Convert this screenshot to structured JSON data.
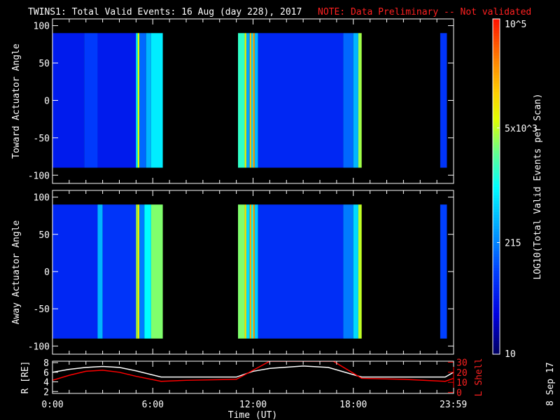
{
  "chart_data": {
    "type": "heatmap",
    "title": "TWINS1: Total Valid Events: 16 Aug (day 228), 2017",
    "note": "NOTE: Data Preliminary -- Not validated",
    "date_stamp": "8 Sep 17",
    "xlabel": "Time (UT)",
    "xlim": [
      0,
      24
    ],
    "xticks": [
      {
        "v": 0,
        "label": "0:00"
      },
      {
        "v": 6,
        "label": "6:00"
      },
      {
        "v": 12,
        "label": "12:00"
      },
      {
        "v": 18,
        "label": "18:00"
      },
      {
        "v": 23.983,
        "label": "23:59"
      }
    ],
    "colorbar": {
      "label": "LOG10(Total Valid Events per Scan)",
      "scale": "log10",
      "range": [
        1,
        5
      ],
      "ticks": [
        {
          "v": 5,
          "label": "10^5"
        },
        {
          "v": 3.699,
          "label": "5x10^3"
        },
        {
          "v": 2.332,
          "label": "215"
        },
        {
          "v": 1,
          "label": "10"
        }
      ]
    },
    "panels": [
      {
        "ylabel": "Toward Actuator Angle",
        "ylim": [
          -111,
          109
        ],
        "yticks": [
          100,
          50,
          0,
          -50,
          -100
        ],
        "angle_range": [
          -90,
          90
        ],
        "bands_hours_log10": [
          [
            0,
            1.9,
            1.7
          ],
          [
            1.9,
            2.7,
            1.95
          ],
          [
            2.7,
            5.0,
            1.7
          ],
          [
            5.0,
            5.1,
            3.0
          ],
          [
            5.1,
            5.2,
            3.8
          ],
          [
            5.2,
            5.6,
            2.2
          ],
          [
            5.6,
            5.9,
            2.6
          ],
          [
            5.9,
            6.6,
            2.9
          ],
          [
            11.1,
            11.5,
            3.2
          ],
          [
            11.5,
            11.6,
            3.9
          ],
          [
            11.6,
            11.8,
            2.5
          ],
          [
            11.8,
            11.9,
            4.2
          ],
          [
            11.9,
            12.0,
            2.8
          ],
          [
            12.0,
            12.1,
            4.4
          ],
          [
            12.1,
            12.3,
            2.6
          ],
          [
            12.3,
            17.4,
            1.8
          ],
          [
            17.4,
            18.0,
            2.2
          ],
          [
            18.0,
            18.3,
            2.6
          ],
          [
            18.3,
            18.5,
            3.6
          ],
          [
            23.2,
            23.6,
            1.9
          ]
        ]
      },
      {
        "ylabel": "Away Actuator Angle",
        "ylim": [
          -111,
          109
        ],
        "yticks": [
          100,
          50,
          0,
          -50,
          -100
        ],
        "angle_range": [
          -90,
          90
        ],
        "bands_hours_log10": [
          [
            0,
            2.7,
            1.8
          ],
          [
            2.7,
            3.0,
            2.6
          ],
          [
            3.0,
            5.0,
            1.9
          ],
          [
            5.0,
            5.1,
            3.6
          ],
          [
            5.1,
            5.2,
            3.9
          ],
          [
            5.2,
            5.5,
            2.3
          ],
          [
            5.5,
            5.9,
            3.0
          ],
          [
            5.9,
            6.6,
            3.5
          ],
          [
            11.1,
            11.5,
            3.5
          ],
          [
            11.5,
            11.6,
            4.0
          ],
          [
            11.6,
            11.8,
            2.8
          ],
          [
            11.8,
            11.9,
            4.3
          ],
          [
            11.9,
            12.0,
            3.0
          ],
          [
            12.0,
            12.1,
            4.4
          ],
          [
            12.1,
            12.3,
            2.7
          ],
          [
            12.3,
            17.4,
            1.85
          ],
          [
            17.4,
            18.0,
            2.3
          ],
          [
            18.0,
            18.3,
            2.8
          ],
          [
            18.3,
            18.5,
            3.7
          ],
          [
            23.2,
            23.6,
            2.0
          ]
        ]
      }
    ],
    "orbit": {
      "ylabel_left": "R [RE]",
      "ylabel_right": "L Shell",
      "ylim_left": [
        1.6,
        8.3
      ],
      "ylim_right": [
        -1,
        31
      ],
      "yticks_left": [
        2,
        4,
        6,
        8
      ],
      "yticks_right": [
        0,
        10,
        20,
        30
      ],
      "series": [
        {
          "name": "R",
          "color": "#ffffff",
          "x": [
            0,
            1,
            2,
            3,
            4,
            5,
            6.5,
            11,
            12,
            13,
            15,
            16.5,
            18.5,
            23.5,
            24
          ],
          "y": [
            6,
            6.6,
            7,
            7.2,
            7,
            6.3,
            5,
            5,
            6.2,
            6.8,
            7.3,
            7,
            5,
            5,
            6
          ]
        },
        {
          "name": "L Shell",
          "color": "#ff0000",
          "x": [
            0,
            1,
            2,
            3,
            4,
            5,
            6.5,
            8,
            11,
            13,
            16.8,
            18.5,
            21,
            23.5,
            24
          ],
          "y": [
            12,
            17,
            21,
            22,
            20,
            16,
            11,
            12,
            13,
            31,
            31,
            14,
            13,
            11,
            14
          ]
        }
      ]
    }
  }
}
